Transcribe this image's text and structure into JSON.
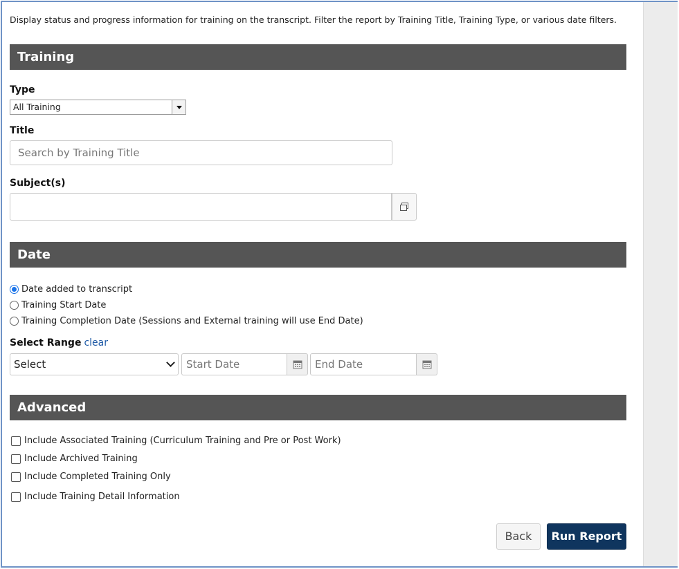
{
  "description": "Display status and progress information for training on the transcript. Filter the report by Training Title, Training Type, or various date filters.",
  "training": {
    "header": "Training",
    "type_label": "Type",
    "type_value": "All Training",
    "title_label": "Title",
    "title_placeholder": "Search by Training Title",
    "subjects_label": "Subject(s)",
    "subjects_value": ""
  },
  "date": {
    "header": "Date",
    "options": [
      {
        "label": "Date added to transcript",
        "selected": true
      },
      {
        "label": "Training Start Date",
        "selected": false
      },
      {
        "label": "Training Completion Date (Sessions and External training will use End Date)",
        "selected": false
      }
    ],
    "range_label": "Select Range",
    "clear_label": "clear",
    "range_value": "Select",
    "start_placeholder": "Start Date",
    "end_placeholder": "End Date"
  },
  "advanced": {
    "header": "Advanced",
    "options": [
      {
        "label": "Include Associated Training (Curriculum Training and Pre or Post Work)",
        "checked": false
      },
      {
        "label": "Include Archived Training",
        "checked": false
      },
      {
        "label": "Include Completed Training Only",
        "checked": false
      },
      {
        "label": "Include Training Detail Information",
        "checked": false
      }
    ]
  },
  "actions": {
    "back_label": "Back",
    "run_label": "Run Report"
  },
  "colors": {
    "section_bar": "#555555",
    "primary_button": "#0f355e",
    "link": "#1f5aa6"
  }
}
